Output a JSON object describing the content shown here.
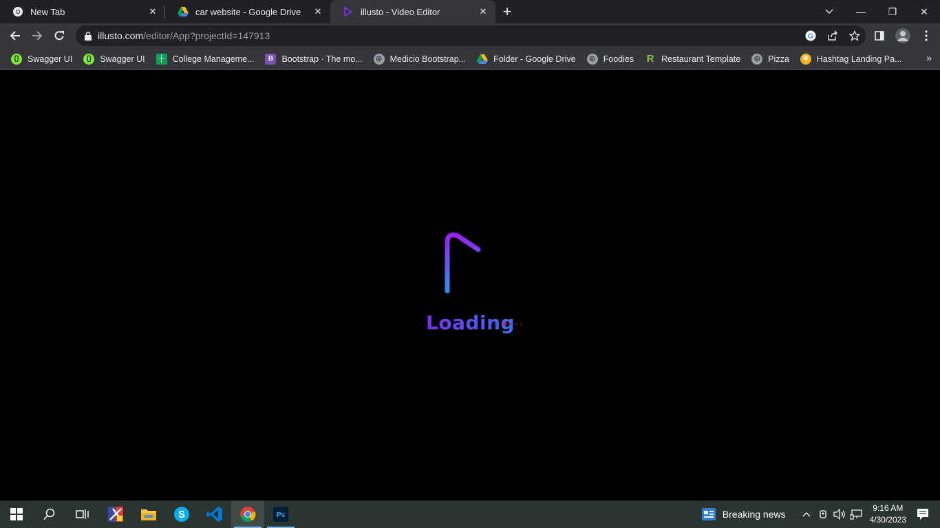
{
  "tabs": [
    {
      "title": "New Tab",
      "icon": "chrome-icon",
      "active": false
    },
    {
      "title": "car website - Google Drive",
      "icon": "google-drive-icon",
      "active": false
    },
    {
      "title": "illusto - Video Editor",
      "icon": "illusto-icon",
      "active": true
    }
  ],
  "address": {
    "host": "illusto.com",
    "path": "/editor/App?projectId=147913"
  },
  "bookmarks": [
    {
      "label": "Swagger UI",
      "icon": "swagger-icon",
      "color": "#85ea2d"
    },
    {
      "label": "Swagger UI",
      "icon": "swagger-icon",
      "color": "#85ea2d"
    },
    {
      "label": "College Manageme...",
      "icon": "sheets-icon",
      "color": "#0f9d58"
    },
    {
      "label": "Bootstrap · The mo...",
      "icon": "bootstrap-icon",
      "color": "#7952b3"
    },
    {
      "label": "Medicio Bootstrap...",
      "icon": "globe-icon",
      "color": "#9aa0a6"
    },
    {
      "label": "Folder - Google Drive",
      "icon": "google-drive-icon",
      "color": "#4285f4"
    },
    {
      "label": "Foodies",
      "icon": "globe-icon",
      "color": "#9aa0a6"
    },
    {
      "label": "Restaurant Template",
      "icon": "r-logo-icon",
      "color": "#8bc34a"
    },
    {
      "label": "Pizza",
      "icon": "globe-icon",
      "color": "#9aa0a6"
    },
    {
      "label": "Hashtag Landing Pa...",
      "icon": "hashtag-icon",
      "color": "#f6b21b"
    }
  ],
  "content": {
    "loading_text": "Loading",
    "accent_start": "#7b2ff7",
    "accent_end": "#3b6ff0",
    "dot_color": "#d6127a"
  },
  "taskbar": {
    "news": "Breaking news",
    "time": "9:16 AM",
    "date": "4/30/2023"
  }
}
